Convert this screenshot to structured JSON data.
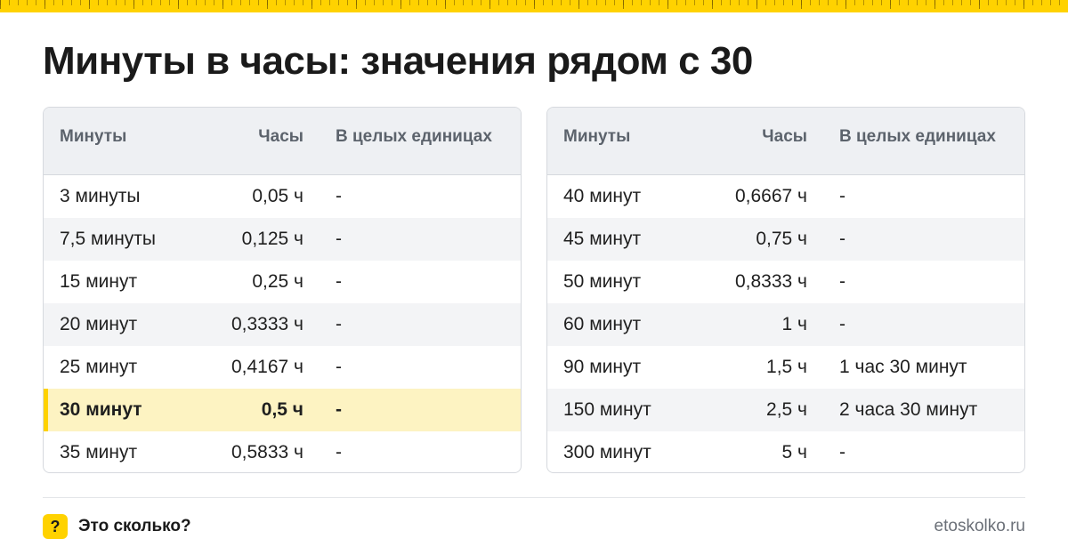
{
  "page": {
    "title": "Минуты в часы: значения рядом с 30"
  },
  "table_headers": {
    "minutes": "Минуты",
    "hours": "Часы",
    "whole_units": "В целых единицах"
  },
  "left_table": {
    "rows": [
      {
        "minutes": "3 минуты",
        "hours": "0,05 ч",
        "whole": "-"
      },
      {
        "minutes": "7,5 минуты",
        "hours": "0,125 ч",
        "whole": "-"
      },
      {
        "minutes": "15 минут",
        "hours": "0,25 ч",
        "whole": "-"
      },
      {
        "minutes": "20 минут",
        "hours": "0,3333 ч",
        "whole": "-"
      },
      {
        "minutes": "25 минут",
        "hours": "0,4167 ч",
        "whole": "-"
      },
      {
        "minutes": "30 минут",
        "hours": "0,5 ч",
        "whole": "-"
      },
      {
        "minutes": "35 минут",
        "hours": "0,5833 ч",
        "whole": "-"
      }
    ]
  },
  "right_table": {
    "rows": [
      {
        "minutes": "40 минут",
        "hours": "0,6667 ч",
        "whole": "-"
      },
      {
        "minutes": "45 минут",
        "hours": "0,75 ч",
        "whole": "-"
      },
      {
        "minutes": "50 минут",
        "hours": "0,8333 ч",
        "whole": "-"
      },
      {
        "minutes": "60 минут",
        "hours": "1 ч",
        "whole": "-"
      },
      {
        "minutes": "90 минут",
        "hours": "1,5 ч",
        "whole": "1 час 30 минут"
      },
      {
        "minutes": "150 минут",
        "hours": "2,5 ч",
        "whole": "2 часа 30 минут"
      },
      {
        "minutes": "300 минут",
        "hours": "5 ч",
        "whole": "-"
      }
    ]
  },
  "footer": {
    "brand_icon_glyph": "?",
    "brand_name": "Это сколько?",
    "site": "etoskolko.ru"
  },
  "colors": {
    "accent": "#ffd200",
    "highlight_row": "#fdf3c2",
    "header_bg": "#eef0f3"
  }
}
